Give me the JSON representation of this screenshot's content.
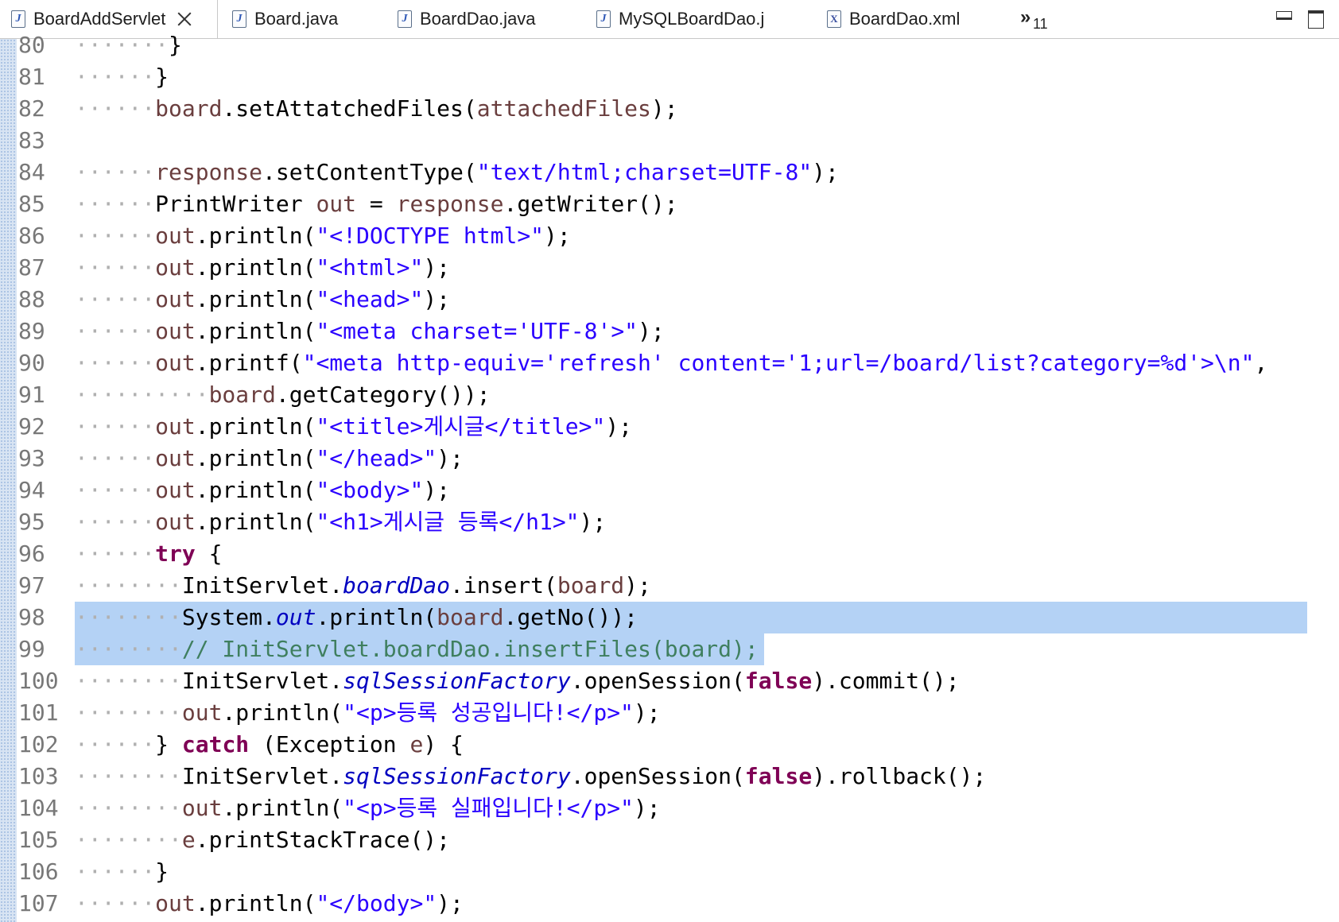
{
  "tabs": [
    {
      "label": "BoardAddServlet",
      "icon": "java-file-icon",
      "active": true,
      "closable": true
    },
    {
      "label": "Board.java",
      "icon": "java-file-icon",
      "active": false
    },
    {
      "label": "BoardDao.java",
      "icon": "java-file-icon",
      "active": false
    },
    {
      "label": "MySQLBoardDao.j",
      "icon": "java-file-icon",
      "active": false
    },
    {
      "label": "BoardDao.xml",
      "icon": "xml-file-icon",
      "active": false
    }
  ],
  "overflow": {
    "symbol": "»",
    "count": "11"
  },
  "window_controls": {
    "minimize_icon": "minimize-icon",
    "maximize_icon": "maximize-icon"
  },
  "editor": {
    "selected_lines": [
      98,
      99
    ],
    "lines": [
      {
        "num": "80",
        "indent": 7,
        "tokens": [
          [
            "p",
            "}"
          ]
        ]
      },
      {
        "num": "81",
        "indent": 6,
        "tokens": [
          [
            "p",
            "}"
          ]
        ]
      },
      {
        "num": "82",
        "indent": 6,
        "tokens": [
          [
            "v",
            "board"
          ],
          [
            "p",
            ".setAttatchedFiles("
          ],
          [
            "v",
            "attachedFiles"
          ],
          [
            "p",
            ");"
          ]
        ]
      },
      {
        "num": "83",
        "indent": 0,
        "tokens": []
      },
      {
        "num": "84",
        "indent": 6,
        "tokens": [
          [
            "v",
            "response"
          ],
          [
            "p",
            ".setContentType("
          ],
          [
            "s",
            "\"text/html;charset=UTF-8\""
          ],
          [
            "p",
            ");"
          ]
        ]
      },
      {
        "num": "85",
        "indent": 6,
        "tokens": [
          [
            "p",
            "PrintWriter "
          ],
          [
            "v",
            "out"
          ],
          [
            "p",
            " = "
          ],
          [
            "v",
            "response"
          ],
          [
            "p",
            ".getWriter();"
          ]
        ]
      },
      {
        "num": "86",
        "indent": 6,
        "tokens": [
          [
            "v",
            "out"
          ],
          [
            "p",
            ".println("
          ],
          [
            "s",
            "\"<!DOCTYPE html>\""
          ],
          [
            "p",
            ");"
          ]
        ]
      },
      {
        "num": "87",
        "indent": 6,
        "tokens": [
          [
            "v",
            "out"
          ],
          [
            "p",
            ".println("
          ],
          [
            "s",
            "\"<html>\""
          ],
          [
            "p",
            ");"
          ]
        ]
      },
      {
        "num": "88",
        "indent": 6,
        "tokens": [
          [
            "v",
            "out"
          ],
          [
            "p",
            ".println("
          ],
          [
            "s",
            "\"<head>\""
          ],
          [
            "p",
            ");"
          ]
        ]
      },
      {
        "num": "89",
        "indent": 6,
        "tokens": [
          [
            "v",
            "out"
          ],
          [
            "p",
            ".println("
          ],
          [
            "s",
            "\"<meta charset='UTF-8'>\""
          ],
          [
            "p",
            ");"
          ]
        ]
      },
      {
        "num": "90",
        "indent": 6,
        "tokens": [
          [
            "v",
            "out"
          ],
          [
            "p",
            ".printf("
          ],
          [
            "s",
            "\"<meta http-equiv='refresh' content='1;url=/board/list?category=%d'>\\n\""
          ],
          [
            "p",
            ","
          ]
        ]
      },
      {
        "num": "91",
        "indent": 10,
        "tokens": [
          [
            "v",
            "board"
          ],
          [
            "p",
            ".getCategory());"
          ]
        ]
      },
      {
        "num": "92",
        "indent": 6,
        "tokens": [
          [
            "v",
            "out"
          ],
          [
            "p",
            ".println("
          ],
          [
            "s",
            "\"<title>게시글</title>\""
          ],
          [
            "p",
            ");"
          ]
        ]
      },
      {
        "num": "93",
        "indent": 6,
        "tokens": [
          [
            "v",
            "out"
          ],
          [
            "p",
            ".println("
          ],
          [
            "s",
            "\"</head>\""
          ],
          [
            "p",
            ");"
          ]
        ]
      },
      {
        "num": "94",
        "indent": 6,
        "tokens": [
          [
            "v",
            "out"
          ],
          [
            "p",
            ".println("
          ],
          [
            "s",
            "\"<body>\""
          ],
          [
            "p",
            ");"
          ]
        ]
      },
      {
        "num": "95",
        "indent": 6,
        "tokens": [
          [
            "v",
            "out"
          ],
          [
            "p",
            ".println("
          ],
          [
            "s",
            "\"<h1>게시글 등록</h1>\""
          ],
          [
            "p",
            ");"
          ]
        ]
      },
      {
        "num": "96",
        "indent": 6,
        "tokens": [
          [
            "k",
            "try"
          ],
          [
            "p",
            " {"
          ]
        ]
      },
      {
        "num": "97",
        "indent": 8,
        "tokens": [
          [
            "p",
            "InitServlet."
          ],
          [
            "f",
            "boardDao"
          ],
          [
            "p",
            ".insert("
          ],
          [
            "v",
            "board"
          ],
          [
            "p",
            ");"
          ]
        ]
      },
      {
        "num": "98",
        "indent": 8,
        "tokens": [
          [
            "p",
            "System."
          ],
          [
            "f",
            "out"
          ],
          [
            "p",
            ".println("
          ],
          [
            "v",
            "board"
          ],
          [
            "p",
            ".getNo());"
          ]
        ]
      },
      {
        "num": "99",
        "indent": 8,
        "tokens": [
          [
            "c",
            "// InitServlet.boardDao.insertFiles(board);"
          ]
        ]
      },
      {
        "num": "100",
        "indent": 8,
        "tokens": [
          [
            "p",
            "InitServlet."
          ],
          [
            "f",
            "sqlSessionFactory"
          ],
          [
            "p",
            ".openSession("
          ],
          [
            "k",
            "false"
          ],
          [
            "p",
            ").commit();"
          ]
        ]
      },
      {
        "num": "101",
        "indent": 8,
        "tokens": [
          [
            "v",
            "out"
          ],
          [
            "p",
            ".println("
          ],
          [
            "s",
            "\"<p>등록 성공입니다!</p>\""
          ],
          [
            "p",
            ");"
          ]
        ]
      },
      {
        "num": "102",
        "indent": 6,
        "tokens": [
          [
            "p",
            "} "
          ],
          [
            "k",
            "catch"
          ],
          [
            "p",
            " (Exception "
          ],
          [
            "v",
            "e"
          ],
          [
            "p",
            ") {"
          ]
        ]
      },
      {
        "num": "103",
        "indent": 8,
        "tokens": [
          [
            "p",
            "InitServlet."
          ],
          [
            "f",
            "sqlSessionFactory"
          ],
          [
            "p",
            ".openSession("
          ],
          [
            "k",
            "false"
          ],
          [
            "p",
            ").rollback();"
          ]
        ]
      },
      {
        "num": "104",
        "indent": 8,
        "tokens": [
          [
            "v",
            "out"
          ],
          [
            "p",
            ".println("
          ],
          [
            "s",
            "\"<p>등록 실패입니다!</p>\""
          ],
          [
            "p",
            ");"
          ]
        ]
      },
      {
        "num": "105",
        "indent": 8,
        "tokens": [
          [
            "v",
            "e"
          ],
          [
            "p",
            ".printStackTrace();"
          ]
        ]
      },
      {
        "num": "106",
        "indent": 6,
        "tokens": [
          [
            "p",
            "}"
          ]
        ]
      },
      {
        "num": "107",
        "indent": 6,
        "tokens": [
          [
            "v",
            "out"
          ],
          [
            "p",
            ".println("
          ],
          [
            "s",
            "\"</body>\""
          ],
          [
            "p",
            ");"
          ]
        ]
      }
    ]
  }
}
